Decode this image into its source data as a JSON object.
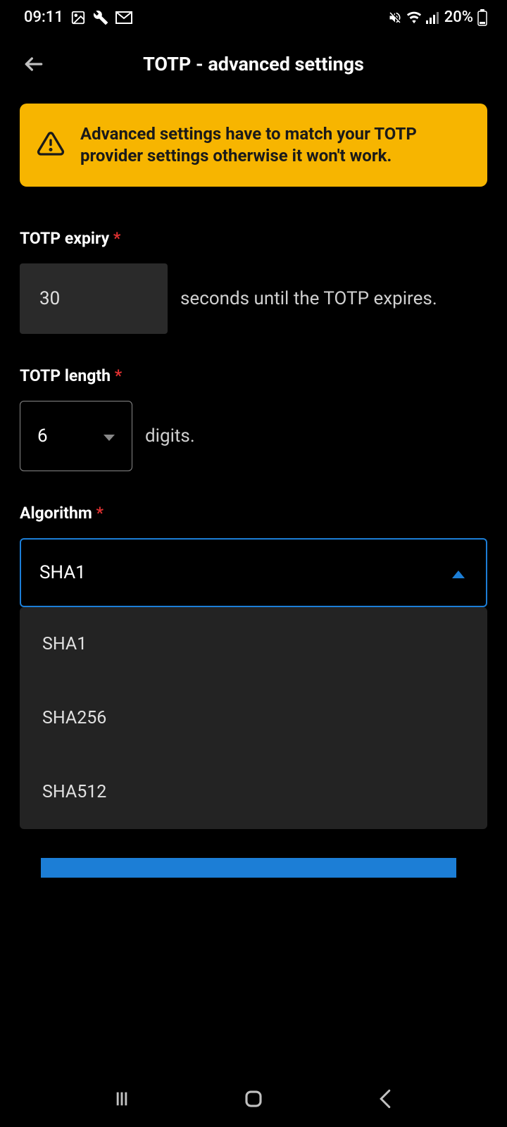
{
  "statusBar": {
    "time": "09:11",
    "battery": "20%"
  },
  "header": {
    "title": "TOTP - advanced settings"
  },
  "warning": {
    "text": "Advanced settings have to match your TOTP provider settings otherwise it won't work."
  },
  "fields": {
    "expiry": {
      "label": "TOTP expiry",
      "value": "30",
      "suffix": "seconds until the TOTP expires."
    },
    "length": {
      "label": "TOTP length",
      "value": "6",
      "suffix": "digits."
    },
    "algorithm": {
      "label": "Algorithm",
      "value": "SHA1",
      "options": [
        "SHA1",
        "SHA256",
        "SHA512"
      ]
    }
  }
}
